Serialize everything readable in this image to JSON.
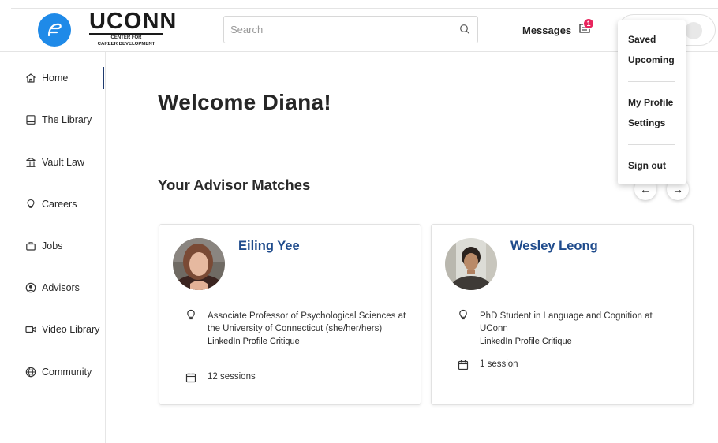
{
  "brand": {
    "name": "UCONN",
    "subtitle_line1": "CENTER FOR",
    "subtitle_line2": "CAREER DEVELOPMENT",
    "accent": "#1f8ae8"
  },
  "search": {
    "placeholder": "Search"
  },
  "header": {
    "messages_label": "Messages",
    "messages_badge": "1",
    "badge_color": "#e8255d"
  },
  "dropdown": {
    "items": [
      "Saved",
      "Upcoming",
      "My Profile",
      "Settings",
      "Sign out"
    ]
  },
  "sidebar": {
    "items": [
      {
        "label": "Home",
        "icon": "home-icon"
      },
      {
        "label": "The Library",
        "icon": "book-icon"
      },
      {
        "label": "Vault Law",
        "icon": "bank-icon"
      },
      {
        "label": "Careers",
        "icon": "lightbulb-icon"
      },
      {
        "label": "Jobs",
        "icon": "briefcase-icon"
      },
      {
        "label": "Advisors",
        "icon": "user-circle-icon"
      },
      {
        "label": "Video Library",
        "icon": "video-icon"
      },
      {
        "label": "Community",
        "icon": "globe-icon"
      }
    ],
    "active": "Home"
  },
  "main": {
    "welcome": "Welcome Diana!",
    "matches_title": "Your Advisor Matches",
    "prev_arrow": "←",
    "next_arrow": "→",
    "advisors": [
      {
        "name": "Eiling Yee",
        "role": "Associate Professor of Psychological Sciences at the University of Connecticut (she/her/hers)",
        "service": "LinkedIn Profile Critique",
        "sessions": "12 sessions"
      },
      {
        "name": "Wesley Leong",
        "role": "PhD Student in Language and Cognition at UConn",
        "service": "LinkedIn Profile Critique",
        "sessions": "1 session"
      }
    ]
  }
}
